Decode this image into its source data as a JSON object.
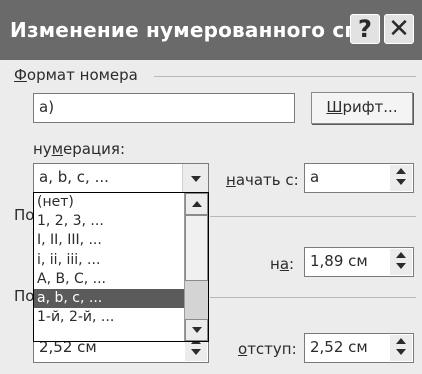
{
  "window": {
    "title": "Изменение нумерованного сп...",
    "help_label": "?",
    "close_label": "✕"
  },
  "number_format": {
    "group_label": "Формат номера",
    "value": "а)",
    "font_button": "Шрифт..."
  },
  "numbering": {
    "label": "нумерация:",
    "selected": "a, b, c, ...",
    "options": [
      "(нет)",
      "1, 2, 3, ...",
      "I, II, III, ...",
      "i, ii, iii, ...",
      "A, B, C, ...",
      "a, b, c, ...",
      "1-й, 2-й, ..."
    ],
    "selected_index": 5
  },
  "start_at": {
    "label": "начать с:",
    "value": "a"
  },
  "number_position": {
    "group_label_fragment": "По",
    "at_label": "на:",
    "at_value": "1,89 см"
  },
  "text_position": {
    "group_label_fragment": "По",
    "left_value": "2,52 см",
    "indent_label": "отступ:",
    "indent_value": "2,52 см"
  },
  "icons": {
    "help": "question-mark-icon",
    "close": "close-x-icon",
    "dropdown": "chevron-down-icon",
    "spin_up": "arrow-up-icon",
    "spin_down": "arrow-down-icon"
  }
}
